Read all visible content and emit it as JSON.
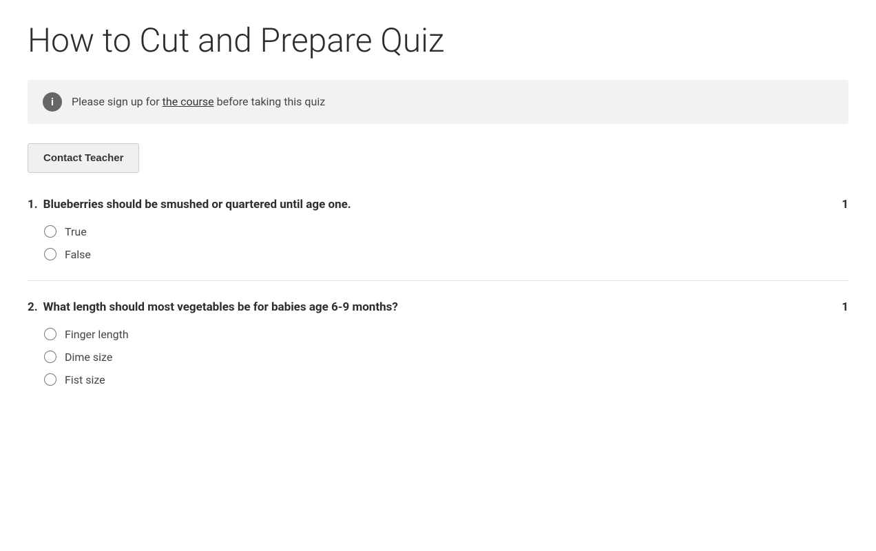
{
  "page": {
    "title": "How to Cut and Prepare Quiz"
  },
  "info_banner": {
    "text_before_link": "Please sign up for ",
    "link_text": "the course",
    "text_after_link": " before taking this quiz"
  },
  "contact_button": {
    "label": "Contact Teacher"
  },
  "questions": [
    {
      "number": "1",
      "text": "Blueberries should be smushed or quartered until age one.",
      "points": "1",
      "options": [
        {
          "id": "q1_true",
          "label": "True"
        },
        {
          "id": "q1_false",
          "label": "False"
        }
      ]
    },
    {
      "number": "2",
      "text": "What length should most vegetables be for babies age 6-9 months?",
      "points": "1",
      "options": [
        {
          "id": "q2_finger",
          "label": "Finger length"
        },
        {
          "id": "q2_dime",
          "label": "Dime size"
        },
        {
          "id": "q2_fist",
          "label": "Fist size"
        }
      ]
    }
  ]
}
